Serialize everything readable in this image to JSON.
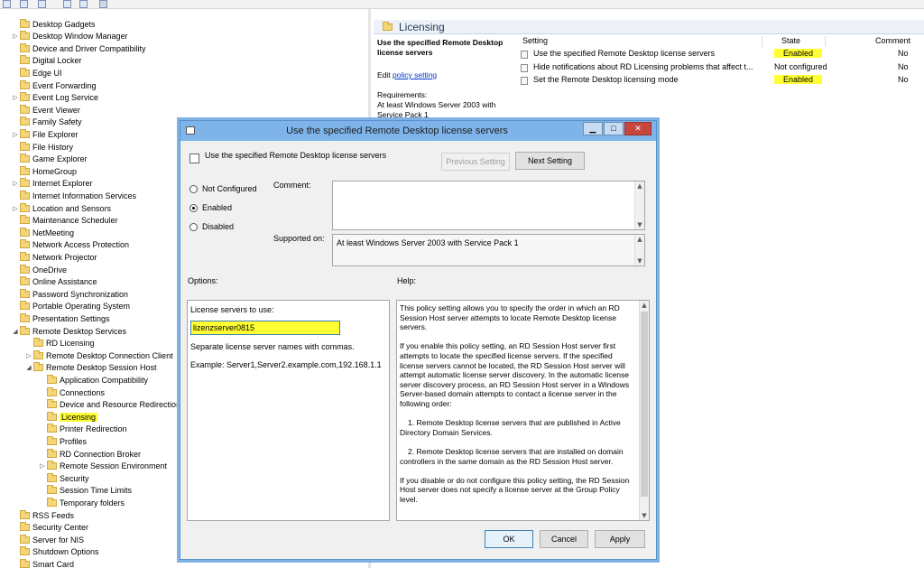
{
  "tree": {
    "items": [
      {
        "label": "Desktop Gadgets",
        "indent": 0,
        "expander": false
      },
      {
        "label": "Desktop Window Manager",
        "indent": 0,
        "expander": true
      },
      {
        "label": "Device and Driver Compatibility",
        "indent": 0,
        "expander": false
      },
      {
        "label": "Digital Locker",
        "indent": 0,
        "expander": false
      },
      {
        "label": "Edge UI",
        "indent": 0,
        "expander": false
      },
      {
        "label": "Event Forwarding",
        "indent": 0,
        "expander": false
      },
      {
        "label": "Event Log Service",
        "indent": 0,
        "expander": true
      },
      {
        "label": "Event Viewer",
        "indent": 0,
        "expander": false
      },
      {
        "label": "Family Safety",
        "indent": 0,
        "expander": false
      },
      {
        "label": "File Explorer",
        "indent": 0,
        "expander": true
      },
      {
        "label": "File History",
        "indent": 0,
        "expander": false
      },
      {
        "label": "Game Explorer",
        "indent": 0,
        "expander": false
      },
      {
        "label": "HomeGroup",
        "indent": 0,
        "expander": false
      },
      {
        "label": "Internet Explorer",
        "indent": 0,
        "expander": true
      },
      {
        "label": "Internet Information Services",
        "indent": 0,
        "expander": false
      },
      {
        "label": "Location and Sensors",
        "indent": 0,
        "expander": true
      },
      {
        "label": "Maintenance Scheduler",
        "indent": 0,
        "expander": false
      },
      {
        "label": "NetMeeting",
        "indent": 0,
        "expander": false
      },
      {
        "label": "Network Access Protection",
        "indent": 0,
        "expander": false
      },
      {
        "label": "Network Projector",
        "indent": 0,
        "expander": false
      },
      {
        "label": "OneDrive",
        "indent": 0,
        "expander": false
      },
      {
        "label": "Online Assistance",
        "indent": 0,
        "expander": false
      },
      {
        "label": "Password Synchronization",
        "indent": 0,
        "expander": false
      },
      {
        "label": "Portable Operating System",
        "indent": 0,
        "expander": false
      },
      {
        "label": "Presentation Settings",
        "indent": 0,
        "expander": false
      },
      {
        "label": "Remote Desktop Services",
        "indent": 0,
        "expander": "open"
      },
      {
        "label": "RD Licensing",
        "indent": 1,
        "expander": false
      },
      {
        "label": "Remote Desktop Connection Client",
        "indent": 1,
        "expander": true
      },
      {
        "label": "Remote Desktop Session Host",
        "indent": 1,
        "expander": "open"
      },
      {
        "label": "Application Compatibility",
        "indent": 2,
        "expander": false
      },
      {
        "label": "Connections",
        "indent": 2,
        "expander": false
      },
      {
        "label": "Device and Resource Redirection",
        "indent": 2,
        "expander": false
      },
      {
        "label": "Licensing",
        "indent": 2,
        "expander": false,
        "selected": true
      },
      {
        "label": "Printer Redirection",
        "indent": 2,
        "expander": false
      },
      {
        "label": "Profiles",
        "indent": 2,
        "expander": false
      },
      {
        "label": "RD Connection Broker",
        "indent": 2,
        "expander": false
      },
      {
        "label": "Remote Session Environment",
        "indent": 2,
        "expander": true
      },
      {
        "label": "Security",
        "indent": 2,
        "expander": false
      },
      {
        "label": "Session Time Limits",
        "indent": 2,
        "expander": false
      },
      {
        "label": "Temporary folders",
        "indent": 2,
        "expander": false
      },
      {
        "label": "RSS Feeds",
        "indent": 0,
        "expander": false
      },
      {
        "label": "Security Center",
        "indent": 0,
        "expander": false
      },
      {
        "label": "Server for NIS",
        "indent": 0,
        "expander": false
      },
      {
        "label": "Shutdown Options",
        "indent": 0,
        "expander": false
      },
      {
        "label": "Smart Card",
        "indent": 0,
        "expander": false
      }
    ]
  },
  "right_pane": {
    "title": "Licensing",
    "desc_title": "Use the specified Remote Desktop license servers",
    "edit_prefix": "Edit ",
    "edit_link": "policy setting",
    "requirements_label": "Requirements:",
    "requirements_text": "At least Windows Server 2003 with Service Pack 1",
    "columns": {
      "setting": "Setting",
      "state": "State",
      "comment": "Comment"
    },
    "rows": [
      {
        "setting": "Use the specified Remote Desktop license servers",
        "state": "Enabled",
        "comment": "No",
        "highlight": true
      },
      {
        "setting": "Hide notifications about RD Licensing problems that affect t...",
        "state": "Not configured",
        "comment": "No",
        "highlight": false
      },
      {
        "setting": "Set the Remote Desktop licensing mode",
        "state": "Enabled",
        "comment": "No",
        "highlight": true
      }
    ]
  },
  "dialog": {
    "title": "Use the specified Remote Desktop license servers",
    "header": "Use the specified Remote Desktop license servers",
    "prev_button": "Previous Setting",
    "next_button": "Next Setting",
    "radio": {
      "not_configured": "Not Configured",
      "enabled": "Enabled",
      "disabled": "Disabled",
      "selected": "enabled"
    },
    "comment_label": "Comment:",
    "supported_label": "Supported on:",
    "supported_value": "At least Windows Server 2003 with Service Pack 1",
    "options_label": "Options:",
    "help_label": "Help:",
    "options": {
      "license_servers_label": "License servers to use:",
      "license_servers_value": "lizenzserver0815",
      "separate_hint": "Separate license server names with commas.",
      "example": "Example: Server1,Server2.example.com,192.168.1.1"
    },
    "help_paragraphs": [
      "This policy setting allows you to specify the order in which an RD Session Host server attempts to locate Remote Desktop license servers.",
      "If you enable this policy setting, an RD Session Host server first attempts to locate the specified license servers. If the specified license servers cannot be located, the RD Session Host server will attempt automatic license server discovery. In the automatic license server discovery process, an RD Session Host server in a Windows Server-based domain attempts to contact a license server in the following order:",
      "1. Remote Desktop license servers that are published in Active Directory Domain Services.",
      "2. Remote Desktop license servers that are installed on domain controllers in the same domain as the RD Session Host server.",
      "If you disable or do not configure this policy setting, the RD Session Host server does not specify a license server at the Group Policy level."
    ],
    "ok_button": "OK",
    "cancel_button": "Cancel",
    "apply_button": "Apply"
  },
  "colors": {
    "highlight": "#ffff33",
    "titlebar": "#7eb4ea",
    "link": "#0033cc"
  }
}
